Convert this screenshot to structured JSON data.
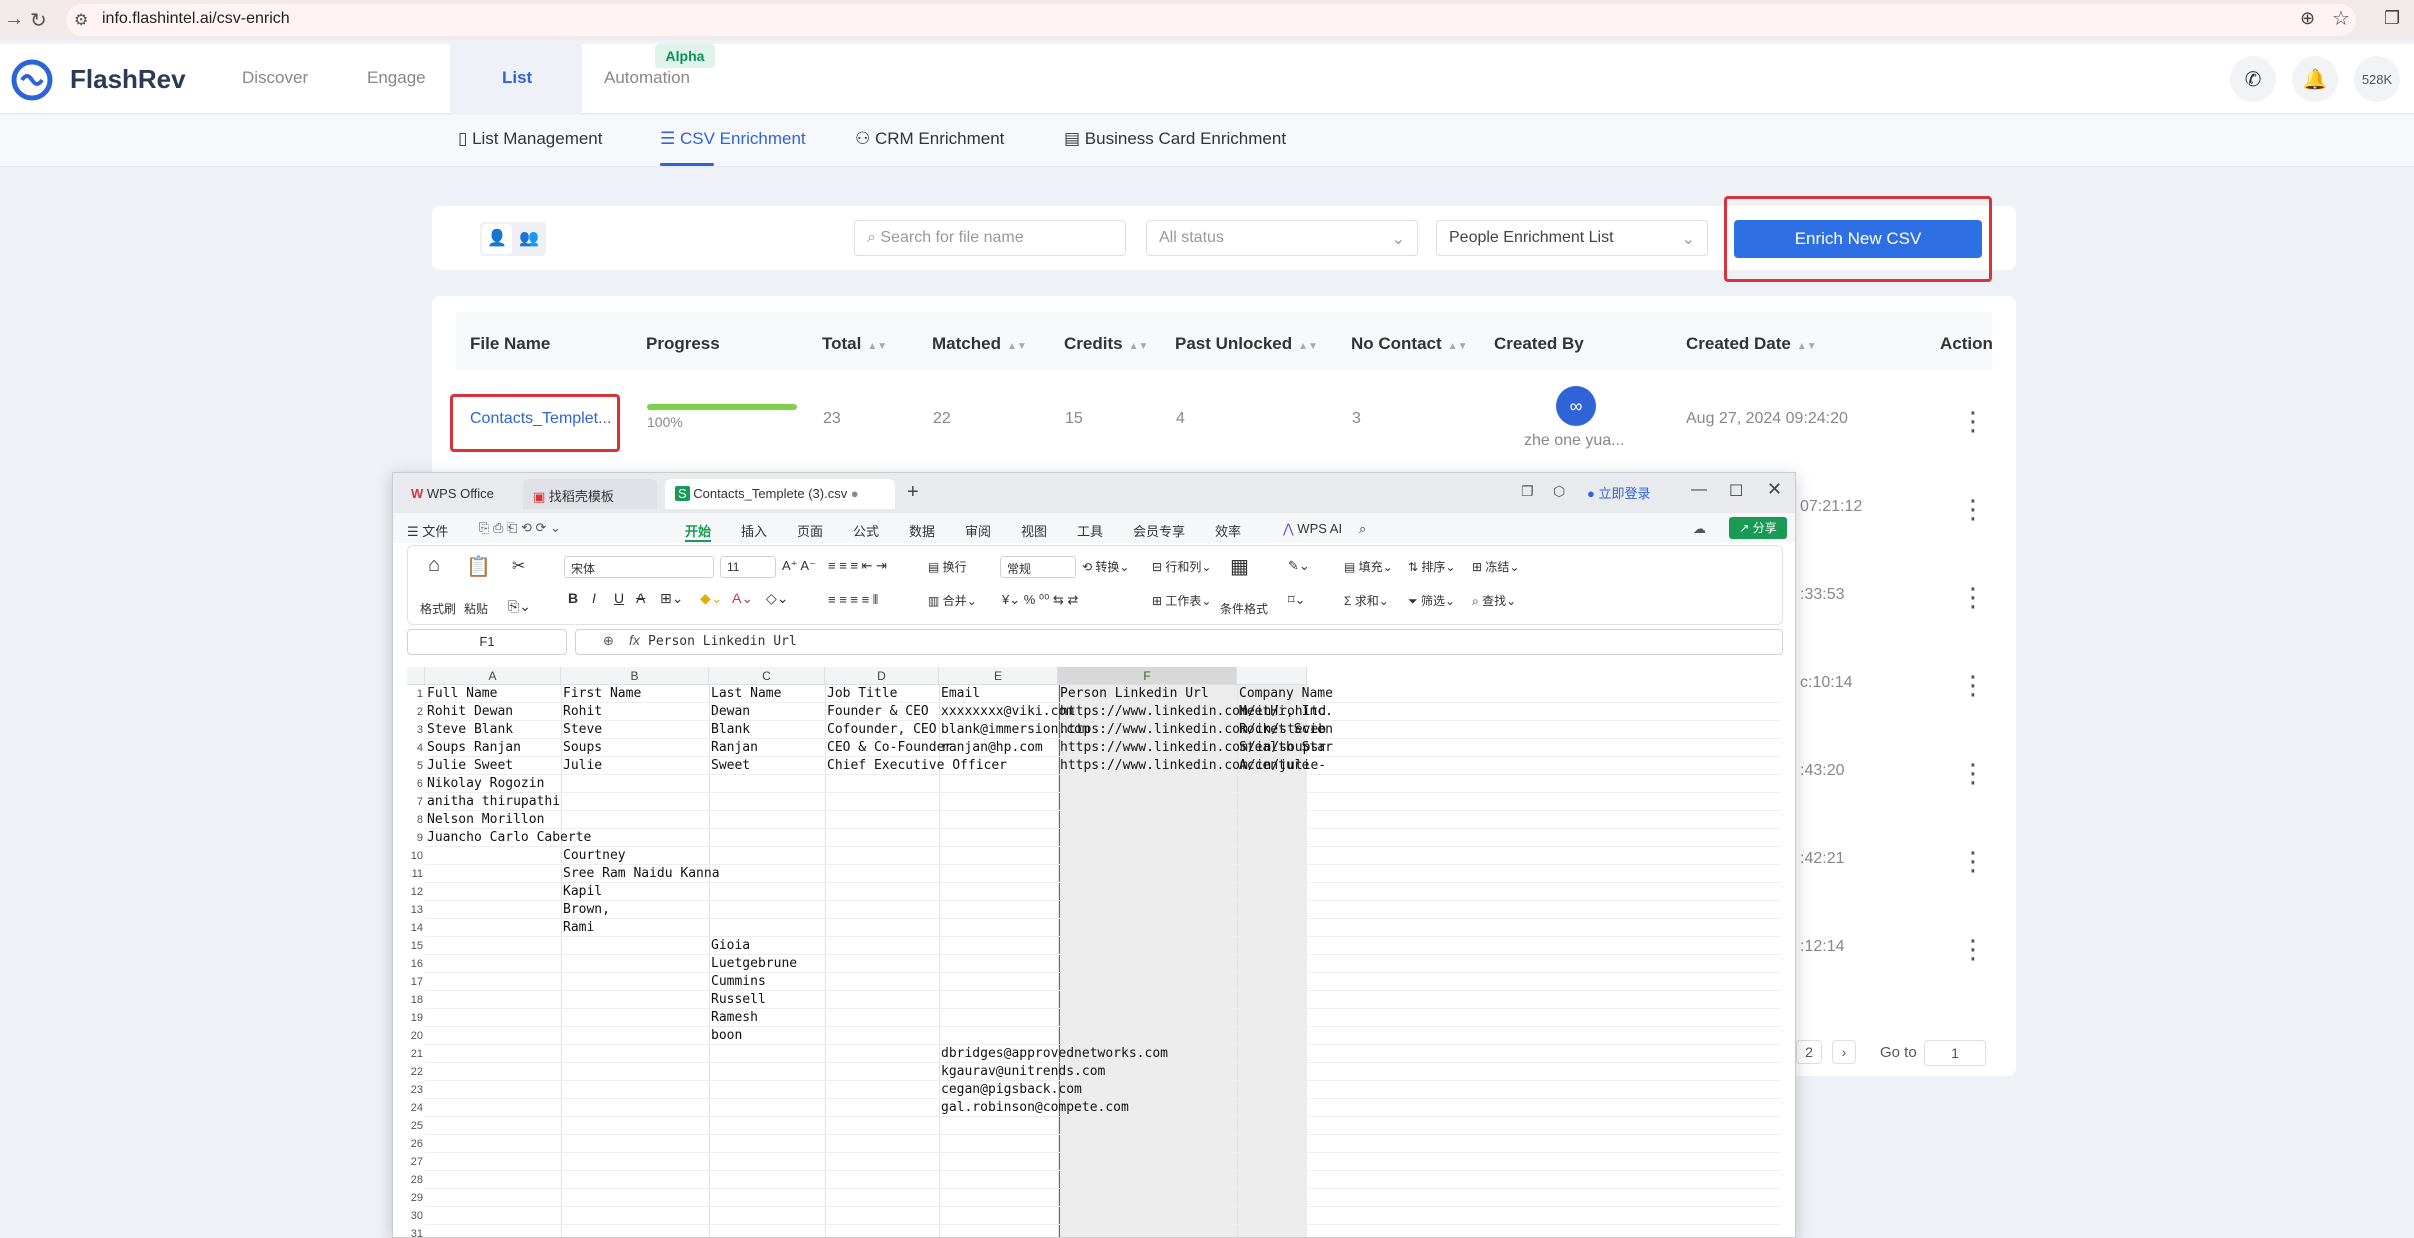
{
  "browser": {
    "url": "info.flashintel.ai/csv-enrich"
  },
  "header": {
    "brand": "FlashRev",
    "nav": [
      {
        "label": "Discover"
      },
      {
        "label": "Engage"
      },
      {
        "label": "List"
      },
      {
        "label": "Automation"
      }
    ],
    "alpha_badge": "Alpha",
    "credits": "528K"
  },
  "subnav": {
    "items": [
      {
        "label": "List Management"
      },
      {
        "label": "CSV Enrichment"
      },
      {
        "label": "CRM Enrichment"
      },
      {
        "label": "Business Card Enrichment"
      }
    ]
  },
  "filters": {
    "search_placeholder": "Search for file name",
    "status": "All status",
    "list_type": "People Enrichment List",
    "enrich_button": "Enrich New CSV"
  },
  "table": {
    "headers": [
      "File Name",
      "Progress",
      "Total",
      "Matched",
      "Credits",
      "Past Unlocked",
      "No Contact",
      "Created By",
      "Created Date",
      "Action"
    ],
    "first_row": {
      "file_name": "Contacts_Templet...",
      "progress_text": "100%",
      "progress": 1.0,
      "total": "23",
      "matched": "22",
      "credits": "15",
      "past_unlocked": "4",
      "no_contact": "3",
      "created_by": "zhe one yua...",
      "created_date": "Aug 27, 2024 09:24:20"
    },
    "partial_dates": [
      "07:21:12",
      ":33:53",
      "c:10:14",
      ":43:20",
      ":42:21",
      ":12:14"
    ],
    "pagination": {
      "page": "2",
      "goto_label": "Go to",
      "goto_value": "1"
    }
  },
  "wps": {
    "tabs": [
      "WPS Office",
      "找稻壳模板",
      "Contacts_Templete (3).csv"
    ],
    "login": "立即登录",
    "menu": [
      "文件",
      "开始",
      "插入",
      "页面",
      "公式",
      "数据",
      "审阅",
      "视图",
      "工具",
      "会员专享",
      "效率",
      "WPS AI"
    ],
    "share": "分享",
    "ribbon": {
      "format_painter": "格式刷",
      "paste": "粘贴",
      "font": "宋体",
      "font_size": "11",
      "wrap": "换行",
      "merge": "合并",
      "number_format": "常规",
      "convert": "转换",
      "row_col": "行和列",
      "worksheet": "工作表",
      "cond_format": "条件格式",
      "fill": "填充",
      "sort": "排序",
      "freeze": "冻结",
      "sum": "求和",
      "filter": "筛选",
      "find": "查找"
    },
    "name_box": "F1",
    "formula": "Person Linkedin Url",
    "columns": [
      "A",
      "B",
      "C",
      "D",
      "E",
      "F"
    ],
    "row_numbers": [
      "1",
      "2",
      "3",
      "4",
      "5",
      "6",
      "7",
      "8",
      "9",
      "10",
      "11",
      "12",
      "13",
      "14",
      "15",
      "16",
      "17",
      "18",
      "19",
      "20",
      "21",
      "22",
      "23",
      "24",
      "25",
      "26",
      "27",
      "28",
      "29",
      "30",
      "31"
    ],
    "cells": {
      "A": [
        "Full Name",
        "Rohit Dewan",
        "Steve Blank",
        "Soups Ranjan",
        "Julie Sweet",
        "Nikolay Rogozin",
        "anitha thirupathi",
        "Nelson Morillon",
        "Juancho Carlo Caberte"
      ],
      "B": {
        "start": 1,
        "values": [
          "First Name",
          "Rohit",
          "Steve",
          "Soups",
          "Julie"
        ]
      },
      "B2": {
        "start": 10,
        "values": [
          "Courtney",
          "Sree Ram Naidu Kanna",
          "Kapil",
          "Brown,",
          "Rami"
        ]
      },
      "C": [
        "Last Name",
        "Dewan",
        "Blank",
        "Ranjan",
        "Sweet"
      ],
      "C2": [
        "Gioia",
        "Luetgebrune",
        "Cummins",
        "Russell",
        "Ramesh",
        "boon"
      ],
      "D": [
        "Job Title",
        "Founder & CEO",
        "Cofounder, CEO",
        "CEO & Co-Founder",
        "Chief Executive Officer"
      ],
      "E": [
        "Email",
        "xxxxxxxx@viki.com",
        "blank@immersion.com",
        "ranjan@hp.com"
      ],
      "E2": [
        "dbridges@approvednetworks.com",
        "kgaurav@unitrends.com",
        "cegan@pigsback.com",
        "gal.robinson@compete.com"
      ],
      "F": [
        "Person Linkedin Url",
        "https://www.linkedin.com/in/rohitd",
        "https://www.linkedin.com/in/steveb",
        "https://www.linkedin.com/in/soupsr",
        "https://www.linkedin.com/in/julie-"
      ],
      "G": [
        "Company Name",
        "MeetHi, Inc.",
        "Rocket Scien",
        "Stealth Star",
        "Accenture"
      ]
    }
  }
}
